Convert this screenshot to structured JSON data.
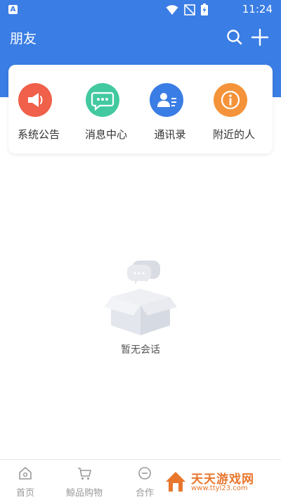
{
  "status_bar": {
    "time": "11:24"
  },
  "header": {
    "title": "朋友"
  },
  "shortcuts": [
    {
      "label": "系统公告",
      "icon": "megaphone-icon",
      "color": "#f0604a"
    },
    {
      "label": "消息中心",
      "icon": "chat-bubble-icon",
      "color": "#43c9a0"
    },
    {
      "label": "通讯录",
      "icon": "contacts-icon",
      "color": "#3a7de4"
    },
    {
      "label": "附近的人",
      "icon": "info-icon",
      "color": "#f5933a"
    }
  ],
  "empty_state": {
    "text": "暂无会话"
  },
  "tabs": [
    {
      "label": "首页",
      "icon": "home-icon"
    },
    {
      "label": "鯨品购物",
      "icon": "cart-icon"
    },
    {
      "label": "合作",
      "icon": "cooperation-icon"
    }
  ],
  "watermark": {
    "name": "天天游戏网",
    "url": "www.ttyl23.com"
  },
  "colors": {
    "header_bg": "#3a7de4",
    "tab_inactive": "#999999",
    "watermark": "#e8762d"
  }
}
